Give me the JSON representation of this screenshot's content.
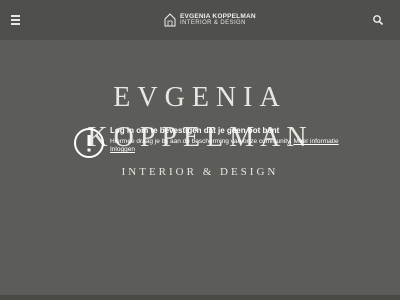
{
  "header": {
    "brand_name": "EVGENIA KOPPELMAN",
    "brand_sub": "INTERIOR & DESIGN",
    "menu_icon": "hamburger-icon",
    "search_icon": "search-icon"
  },
  "hero": {
    "line1": "EVGENIA",
    "line2": "KOPPELMAN",
    "line3": "INTERIOR & DESIGN"
  },
  "notice": {
    "icon": "warning-icon",
    "title": "Log in om te bevestigen dat je geen bot bent",
    "body": "Hiermee draag je bij aan de bescherming van onze community.",
    "more_link": "Meer informatie",
    "login_link": "Inloggen"
  },
  "colors": {
    "background": "#5c5c58",
    "header": "#4f4f4c",
    "text": "#e7e7e3"
  }
}
